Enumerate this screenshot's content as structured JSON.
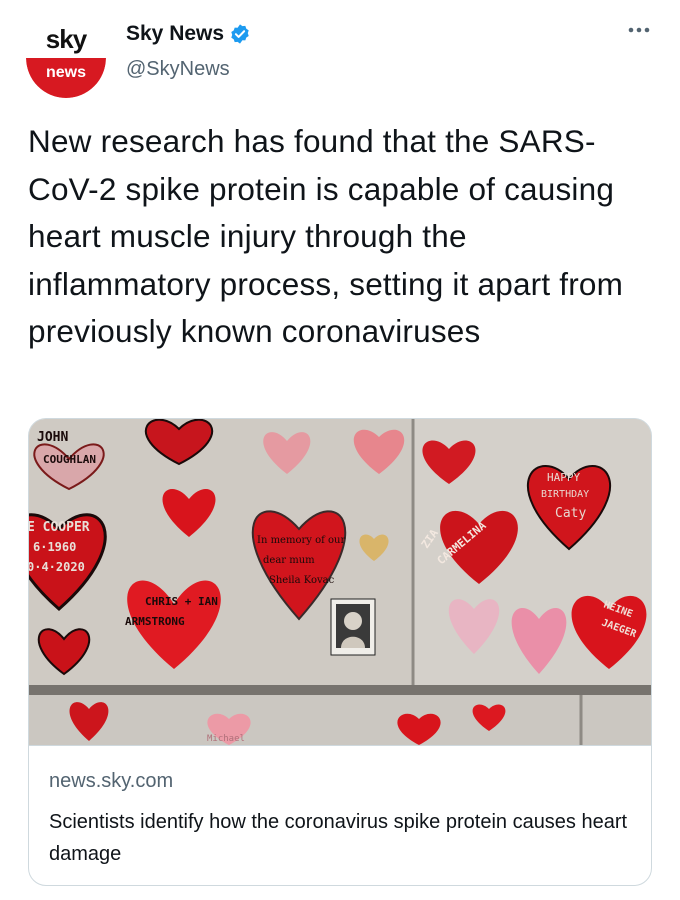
{
  "account": {
    "logo_top": "sky",
    "logo_bottom": "news",
    "display_name": "Sky News",
    "handle": "@SkyNews",
    "verified": true
  },
  "colors": {
    "brand_red": "#d71921",
    "verified_blue": "#1d9bf0",
    "secondary_text": "#536471"
  },
  "icons": {
    "verified": "verified-badge-icon",
    "more": "more-options-icon"
  },
  "tweet": {
    "text": "New research has found that the SARS-CoV-2 spike protein is capable of causing heart muscle injury through the inflammatory process, setting it apart from previously known coronaviruses"
  },
  "card": {
    "image_texts": {
      "t1": "JOHN",
      "t2": "COUGHLAN",
      "t3": "E COOPER",
      "t4": "6·1960",
      "t5": "0·4·2020",
      "t6": "CHRIS + IAN",
      "t7": "ARMSTRONG",
      "t8": "In memory of our",
      "t9": "dear mum",
      "t10": "Sheila Kovac",
      "t11": "ZIA",
      "t12": "CARMELINA",
      "t13": "HAPPY",
      "t14": "BIRTHDAY",
      "t15": "Caty",
      "t16": "HEINE",
      "t17": "JAEGER",
      "t18": "Michael"
    },
    "domain": "news.sky.com",
    "title": "Scientists identify how the coronavirus spike protein causes heart damage"
  }
}
